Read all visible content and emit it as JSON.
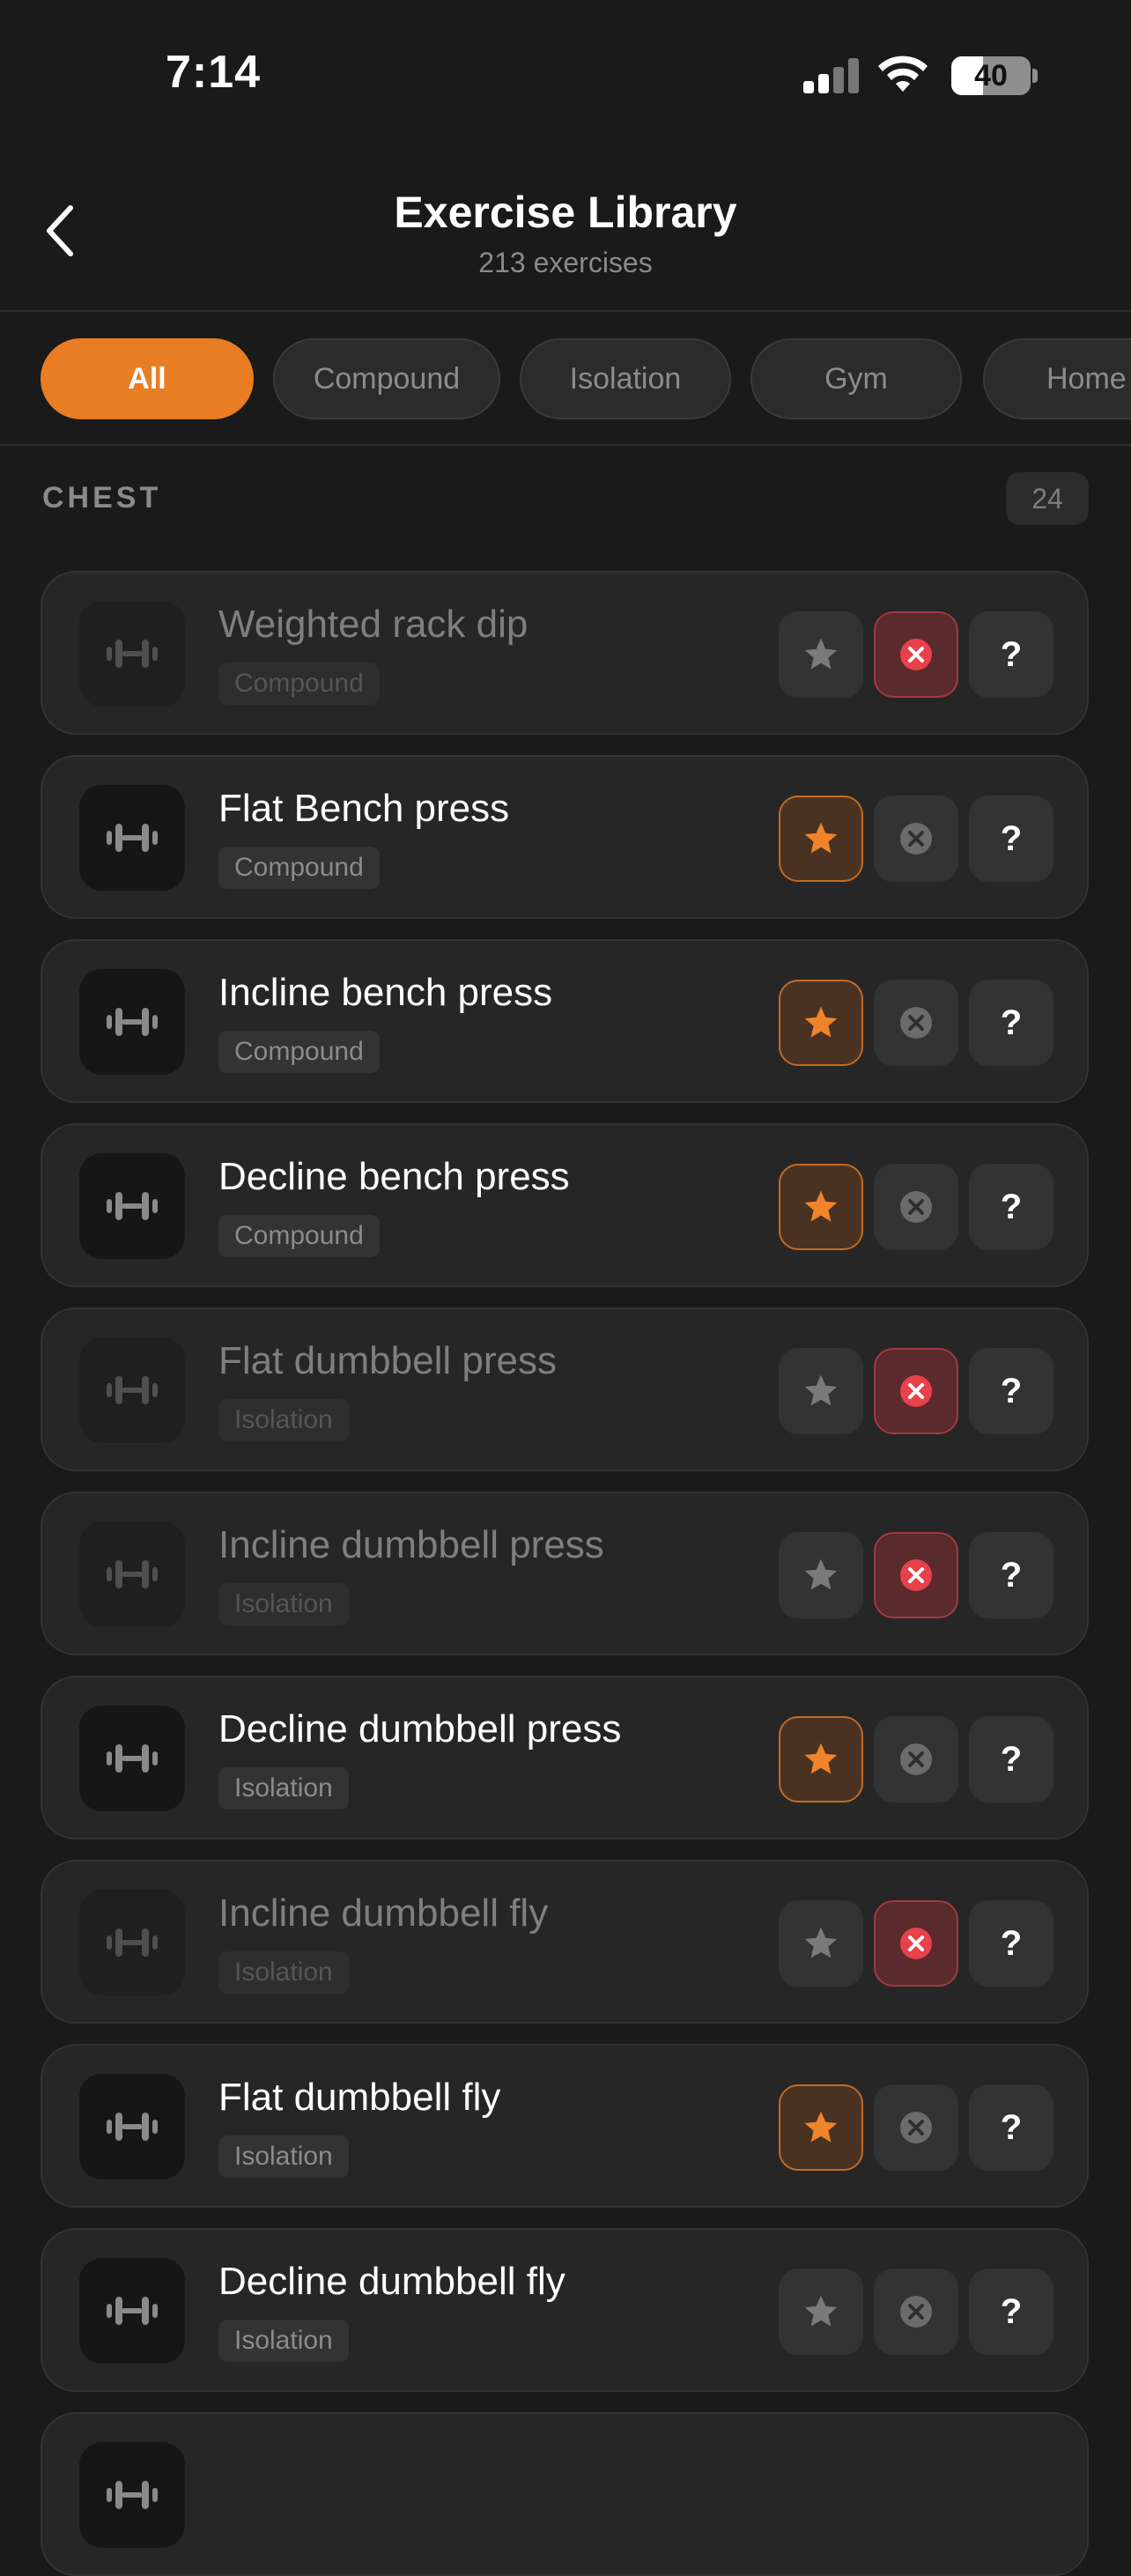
{
  "status_bar": {
    "time": "7:14",
    "battery": "40"
  },
  "header": {
    "title": "Exercise Library",
    "subtitle": "213 exercises"
  },
  "filters": [
    {
      "label": "All",
      "active": true
    },
    {
      "label": "Compound",
      "active": false
    },
    {
      "label": "Isolation",
      "active": false
    },
    {
      "label": "Gym",
      "active": false
    },
    {
      "label": "Home",
      "active": false
    }
  ],
  "section": {
    "title": "CHEST",
    "count": "24"
  },
  "exercises": [
    {
      "name": "Weighted rack dip",
      "tag": "Compound",
      "favorited": false,
      "excluded": true
    },
    {
      "name": "Flat Bench press",
      "tag": "Compound",
      "favorited": true,
      "excluded": false
    },
    {
      "name": "Incline bench press",
      "tag": "Compound",
      "favorited": true,
      "excluded": false
    },
    {
      "name": "Decline bench press",
      "tag": "Compound",
      "favorited": true,
      "excluded": false
    },
    {
      "name": "Flat dumbbell press",
      "tag": "Isolation",
      "favorited": false,
      "excluded": true
    },
    {
      "name": "Incline dumbbell press",
      "tag": "Isolation",
      "favorited": false,
      "excluded": true
    },
    {
      "name": "Decline dumbbell press",
      "tag": "Isolation",
      "favorited": true,
      "excluded": false
    },
    {
      "name": "Incline dumbbell fly",
      "tag": "Isolation",
      "favorited": false,
      "excluded": true
    },
    {
      "name": "Flat dumbbell fly",
      "tag": "Isolation",
      "favorited": true,
      "excluded": false
    },
    {
      "name": "Decline dumbbell fly",
      "tag": "Isolation",
      "favorited": false,
      "excluded": false
    }
  ],
  "help_label": "?",
  "icons": {
    "back": "chevron-left-icon",
    "thumb": "dumbbell-icon",
    "favorite": "star-icon",
    "exclude": "close-circle-icon"
  },
  "colors": {
    "accent": "#e87d24",
    "background": "#1a1a1a",
    "card": "#262626",
    "exclude_red": "#e8414a"
  }
}
